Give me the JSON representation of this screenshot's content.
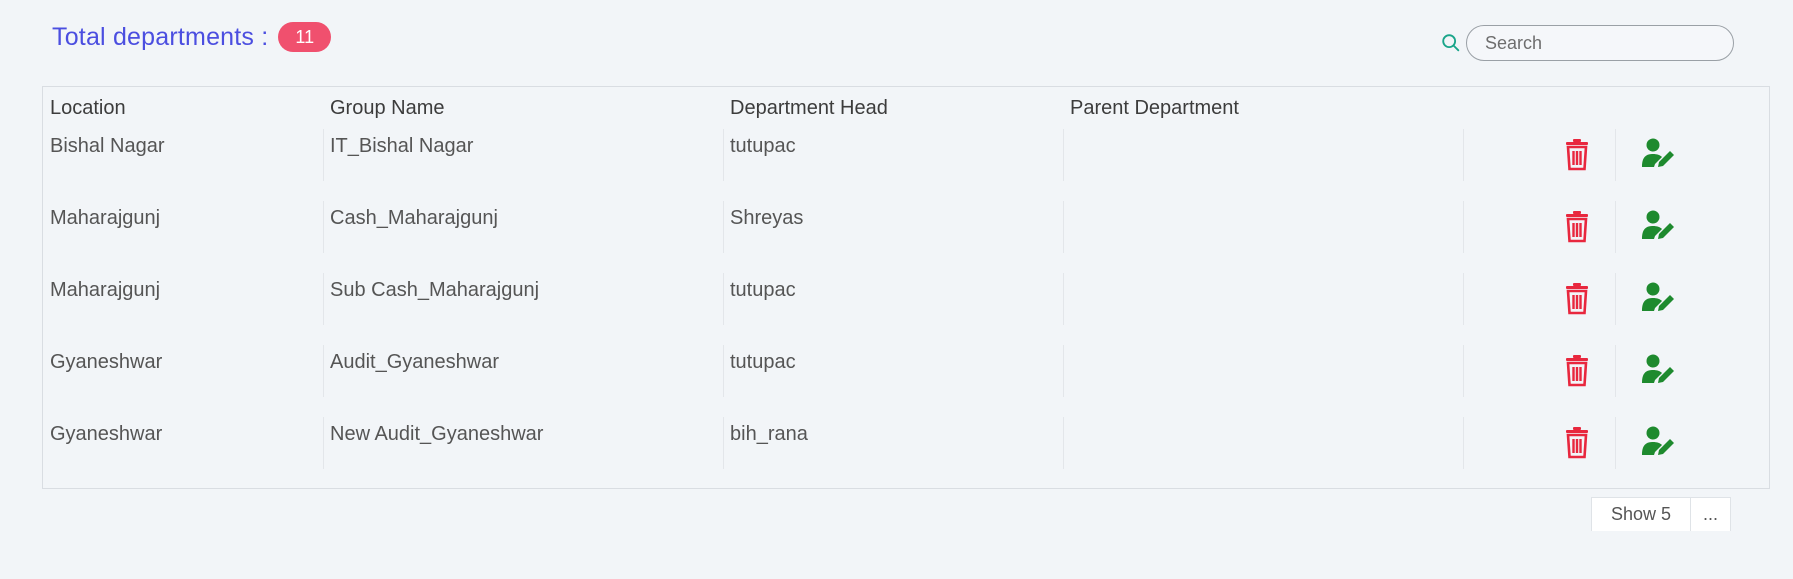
{
  "header": {
    "title": "Total departments :",
    "count": "11"
  },
  "search": {
    "placeholder": "Search",
    "value": ""
  },
  "table": {
    "columns": [
      "Location",
      "Group Name",
      "Department Head",
      "Parent Department"
    ],
    "rows": [
      {
        "location": "Bishal Nagar",
        "group_name": "IT_Bishal Nagar",
        "department_head": "tutupac",
        "parent_department": ""
      },
      {
        "location": "Maharajgunj",
        "group_name": "Cash_Maharajgunj",
        "department_head": "Shreyas",
        "parent_department": ""
      },
      {
        "location": "Maharajgunj",
        "group_name": "Sub Cash_Maharajgunj",
        "department_head": "tutupac",
        "parent_department": ""
      },
      {
        "location": "Gyaneshwar",
        "group_name": "Audit_Gyaneshwar",
        "department_head": "tutupac",
        "parent_department": ""
      },
      {
        "location": "Gyaneshwar",
        "group_name": "New Audit_Gyaneshwar",
        "department_head": "bih_rana",
        "parent_department": ""
      }
    ]
  },
  "row_actions": {
    "delete_icon": "trash-icon",
    "edit_icon": "user-edit-icon",
    "delete_color": "#e8273e",
    "edit_color": "#1e8a2e"
  },
  "pagination": {
    "show_label": "Show 5",
    "more_label": "..."
  },
  "colors": {
    "title": "#4b4ee0",
    "badge": "#f0506e",
    "search_icon": "#1aa58a",
    "background": "#f2f5f8"
  }
}
